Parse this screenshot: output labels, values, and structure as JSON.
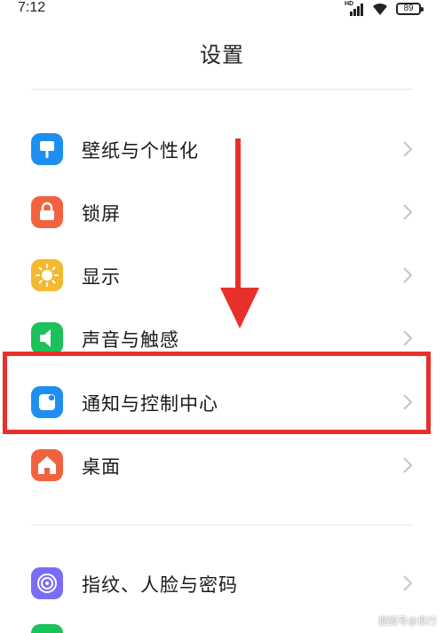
{
  "status_bar": {
    "time": "7:12",
    "network_badge": "HD",
    "battery_level": "89",
    "icons": [
      "signal-icon",
      "wifi-icon",
      "battery-icon"
    ]
  },
  "page": {
    "title": "设置"
  },
  "settings": {
    "items": [
      {
        "label": "壁纸与个性化",
        "icon": "wallpaper-icon",
        "color": "#1E8FF0"
      },
      {
        "label": "锁屏",
        "icon": "lock-icon",
        "color": "#F2623F"
      },
      {
        "label": "显示",
        "icon": "brightness-icon",
        "color": "#F5B82E"
      },
      {
        "label": "声音与触感",
        "icon": "speaker-icon",
        "color": "#1BC15A"
      },
      {
        "label": "通知与控制中心",
        "icon": "notification-icon",
        "color": "#1E8FF0"
      },
      {
        "label": "桌面",
        "icon": "home-icon",
        "color": "#F2623F"
      },
      {
        "label": "指纹、人脸与密码",
        "icon": "fingerprint-icon",
        "color": "#7B6CF6"
      }
    ]
  },
  "annotation": {
    "highlight_color": "#E8302A",
    "highlighted_item": "通知与控制中心"
  },
  "watermark": "搜狐号@良行"
}
